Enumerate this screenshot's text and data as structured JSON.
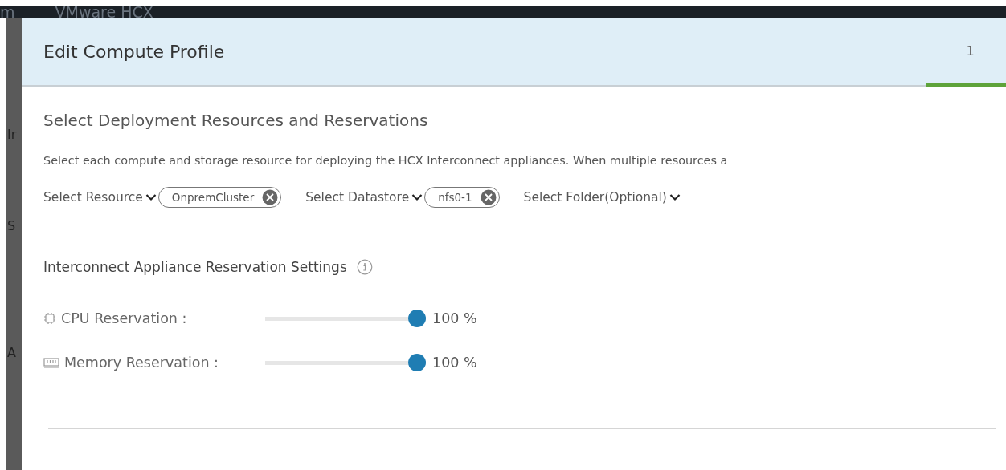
{
  "app_header": {
    "left_text": "m",
    "title": "VMware HCX"
  },
  "side_letters": [
    "Ir",
    "S",
    "A"
  ],
  "dialog": {
    "title": "Edit Compute Profile",
    "steps": [
      {
        "label": "1",
        "selected": true
      }
    ],
    "heading": "Select Deployment Resources and Reservations",
    "description": "Select each compute and storage resource for deploying the HCX Interconnect appliances. When multiple resources a",
    "selectors": [
      {
        "label": "Select Resource",
        "chip": "OnpremCluster"
      },
      {
        "label": "Select Datastore",
        "chip": "nfs0-1"
      },
      {
        "label": "Select Folder(Optional)"
      }
    ],
    "reservation_heading": "Interconnect Appliance Reservation Settings",
    "reservations": [
      {
        "kind": "cpu",
        "label": "CPU Reservation :",
        "level": 1,
        "reading": "100 %"
      },
      {
        "kind": "memory",
        "label": "Memory Reservation :",
        "level": 1,
        "reading": "100 %"
      }
    ]
  }
}
